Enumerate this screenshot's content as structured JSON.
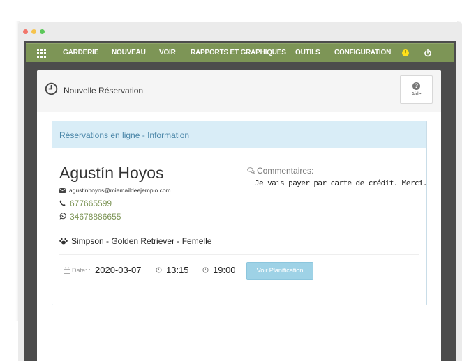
{
  "window": {
    "controls": [
      "close",
      "minimize",
      "maximize"
    ]
  },
  "navbar": {
    "grid_icon": "grid-icon",
    "items": [
      {
        "label": "GARDERIE"
      },
      {
        "label": "NOUVEAU"
      },
      {
        "label": "VOIR"
      },
      {
        "label": "RAPPORTS ET GRAPHIQUES"
      },
      {
        "label": "OUTILS"
      },
      {
        "label": "CONFIGURATION"
      }
    ],
    "info_icon_glyph": "!",
    "power_icon": "power-icon",
    "color": "#7d9556"
  },
  "header": {
    "icon": "clock-icon",
    "title": "Nouvelle Réservation",
    "help": {
      "glyph": "?",
      "label": "Aide"
    }
  },
  "reservation": {
    "box_title": "Réservations en ligne - Information",
    "client": {
      "name": "Agustín Hoyos",
      "email": "agustinhoyos@miemaildeejemplo.com",
      "phone": "677665599",
      "whatsapp": "34678886655"
    },
    "comments": {
      "label": "Commentaires:",
      "text": "Je vais payer par carte de crédit. Merci."
    },
    "pet": "Simpson - Golden Retriever - Femelle",
    "schedule": {
      "date_label": "Date: :",
      "date": "2020-03-07",
      "start_time": "13:15",
      "end_time": "19:00"
    },
    "plan_button": "Voir Planification"
  },
  "colors": {
    "accent_green": "#7d9556",
    "info_bg": "#d9edf7",
    "info_text": "#4a86a8",
    "button_blue": "#9ed2e6"
  }
}
